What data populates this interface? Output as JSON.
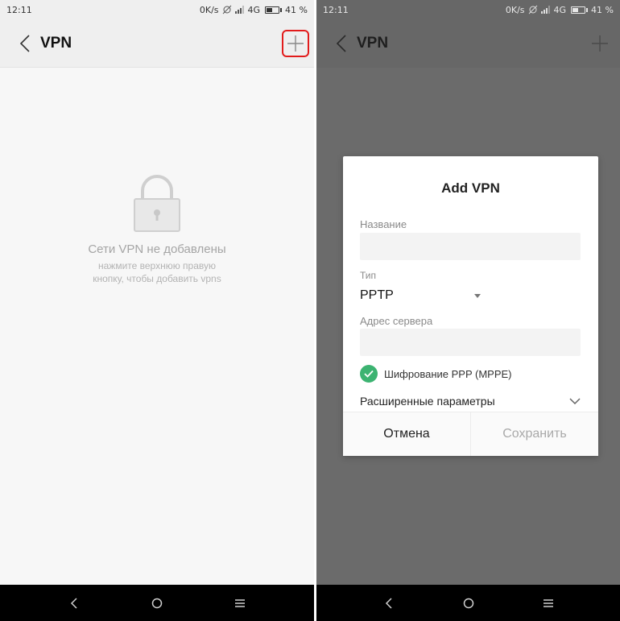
{
  "left": {
    "status": {
      "time": "12:11",
      "net_speed": "0K/s",
      "network": "4G",
      "battery": "41 %"
    },
    "header": {
      "title": "VPN"
    },
    "empty": {
      "title": "Сети VPN не добавлены",
      "subtitle_line1": "нажмите верхнюю правую",
      "subtitle_line2": "кнопку, чтобы добавить vpns"
    }
  },
  "right": {
    "status": {
      "time": "12:11",
      "net_speed": "0K/s",
      "network": "4G",
      "battery": "41 %"
    },
    "header": {
      "title": "VPN"
    },
    "dialog": {
      "title": "Add VPN",
      "name_label": "Название",
      "name_value": "",
      "type_label": "Тип",
      "type_value": "PPTP",
      "server_label": "Адрес сервера",
      "server_value": "",
      "encryption_label": "Шифрование PPP (MPPE)",
      "encryption_checked": true,
      "advanced_label": "Расширенные параметры",
      "cancel_label": "Отмена",
      "save_label": "Сохранить"
    }
  },
  "icons": {
    "back": "chevron-left-icon",
    "add": "plus-icon",
    "lock": "lock-icon",
    "check": "check-circle-icon",
    "dropdown": "triangle-down-icon",
    "expand": "chevron-down-icon",
    "nav_back": "chevron-left-icon",
    "nav_home": "circle-icon",
    "nav_menu": "menu-icon"
  },
  "colors": {
    "accent_check": "#3cb371",
    "highlight_box": "#e21c1c",
    "scrim": "#6b6b6b"
  }
}
